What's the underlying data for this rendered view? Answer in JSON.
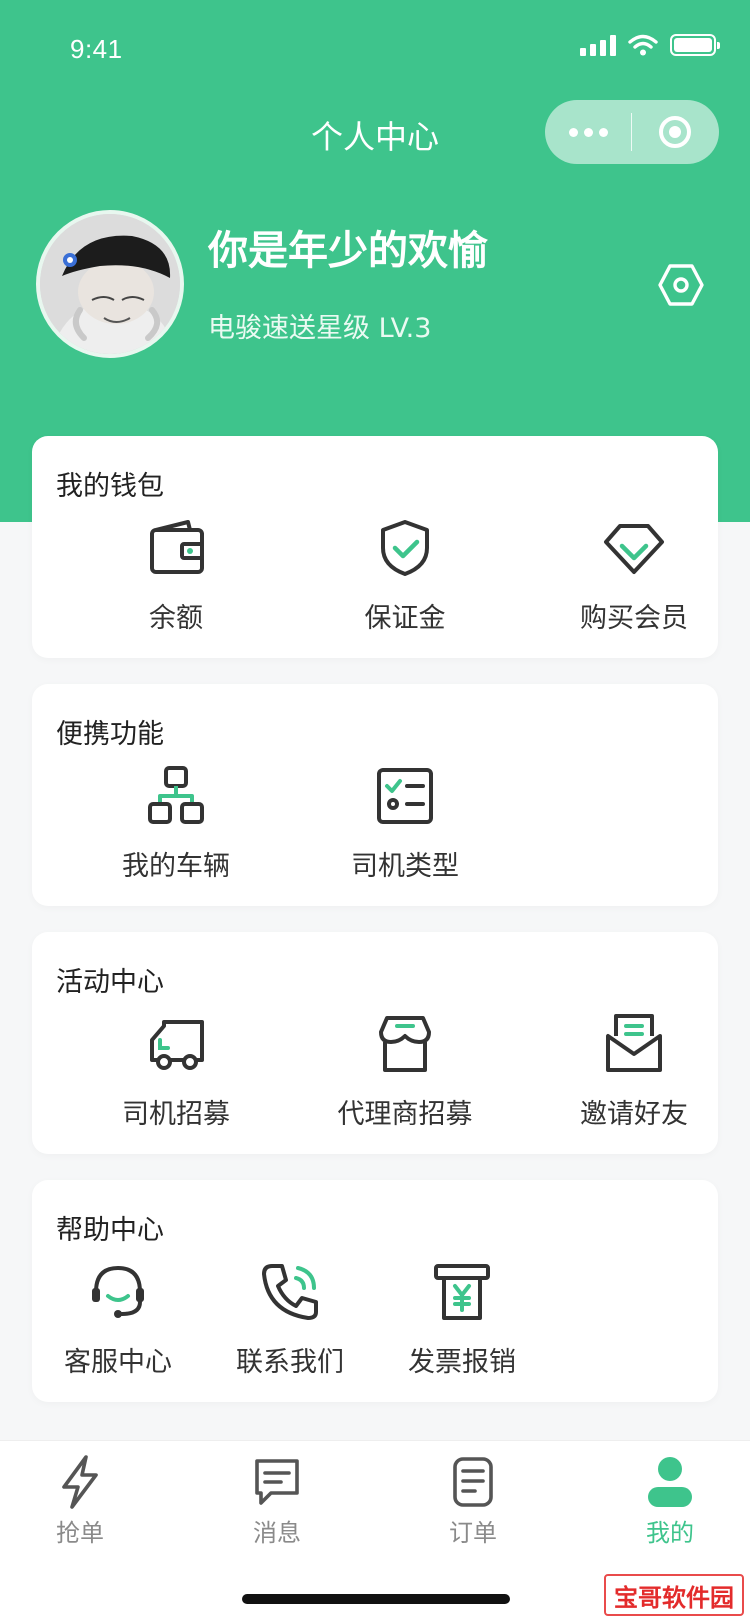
{
  "status_bar": {
    "time": "9:41"
  },
  "nav": {
    "title": "个人中心"
  },
  "profile": {
    "name": "你是年少的欢愉",
    "level": "电骏速送星级 LV.3"
  },
  "sections": [
    {
      "title": "我的钱包",
      "items": [
        {
          "label": "余额",
          "icon": "wallet-icon"
        },
        {
          "label": "保证金",
          "icon": "shield-check-icon"
        },
        {
          "label": "购买会员",
          "icon": "diamond-icon"
        }
      ]
    },
    {
      "title": "便携功能",
      "items": [
        {
          "label": "我的车辆",
          "icon": "hierarchy-icon"
        },
        {
          "label": "司机类型",
          "icon": "checklist-icon"
        }
      ]
    },
    {
      "title": "活动中心",
      "items": [
        {
          "label": "司机招募",
          "icon": "truck-icon"
        },
        {
          "label": "代理商招募",
          "icon": "store-icon"
        },
        {
          "label": "邀请好友",
          "icon": "envelope-icon"
        }
      ]
    },
    {
      "title": "帮助中心",
      "items": [
        {
          "label": "客服中心",
          "icon": "headset-icon"
        },
        {
          "label": "联系我们",
          "icon": "phone-icon"
        },
        {
          "label": "发票报销",
          "icon": "invoice-icon"
        }
      ]
    }
  ],
  "tabbar": [
    {
      "label": "抢单",
      "icon": "lightning-icon"
    },
    {
      "label": "消息",
      "icon": "message-icon"
    },
    {
      "label": "订单",
      "icon": "order-icon"
    },
    {
      "label": "我的",
      "icon": "user-icon",
      "active": true
    }
  ],
  "watermark": "宝哥软件园",
  "colors": {
    "primary": "#3ec48c",
    "icon_dark": "#333333",
    "background": "#f6f7f8"
  }
}
